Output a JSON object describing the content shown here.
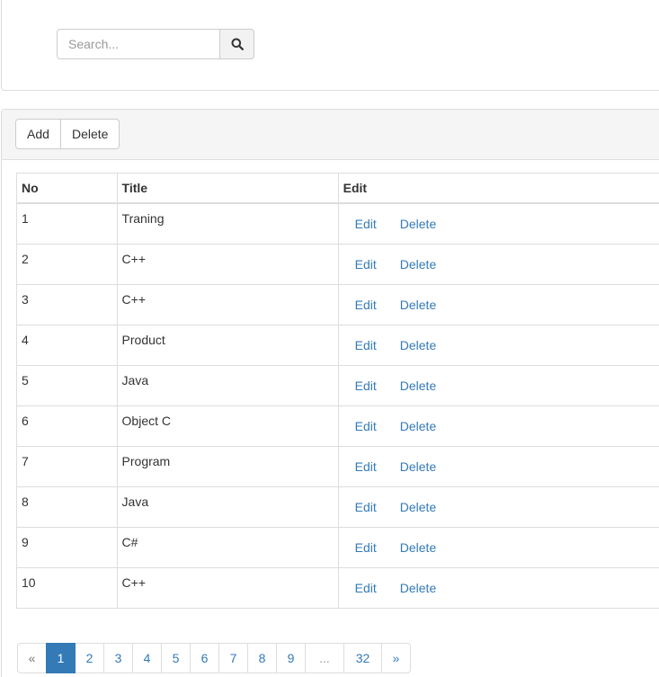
{
  "search": {
    "placeholder": "Search...",
    "button_icon": "search-icon"
  },
  "toolbar": {
    "add_label": "Add",
    "delete_label": "Delete"
  },
  "table": {
    "headers": {
      "no": "No",
      "title": "Title",
      "edit": "Edit"
    },
    "rows": [
      {
        "no": "1",
        "title": "Traning",
        "edit": "Edit",
        "delete": "Delete"
      },
      {
        "no": "2",
        "title": "C++",
        "edit": "Edit",
        "delete": "Delete"
      },
      {
        "no": "3",
        "title": "C++",
        "edit": "Edit",
        "delete": "Delete"
      },
      {
        "no": "4",
        "title": "Product",
        "edit": "Edit",
        "delete": "Delete"
      },
      {
        "no": "5",
        "title": "Java",
        "edit": "Edit",
        "delete": "Delete"
      },
      {
        "no": "6",
        "title": "Object C",
        "edit": "Edit",
        "delete": "Delete"
      },
      {
        "no": "7",
        "title": "Program",
        "edit": "Edit",
        "delete": "Delete"
      },
      {
        "no": "8",
        "title": "Java",
        "edit": "Edit",
        "delete": "Delete"
      },
      {
        "no": "9",
        "title": "C#",
        "edit": "Edit",
        "delete": "Delete"
      },
      {
        "no": "10",
        "title": "C++",
        "edit": "Edit",
        "delete": "Delete"
      }
    ]
  },
  "pagination": {
    "prev": "«",
    "pages": [
      "1",
      "2",
      "3",
      "4",
      "5",
      "6",
      "7",
      "8",
      "9"
    ],
    "ellipsis": "...",
    "last": "32",
    "next": "»",
    "active_page": "1"
  },
  "colors": {
    "link": "#337ab7",
    "active_page_bg": "#337ab7",
    "heading_bg": "#f5f5f5",
    "border": "#dddddd"
  }
}
